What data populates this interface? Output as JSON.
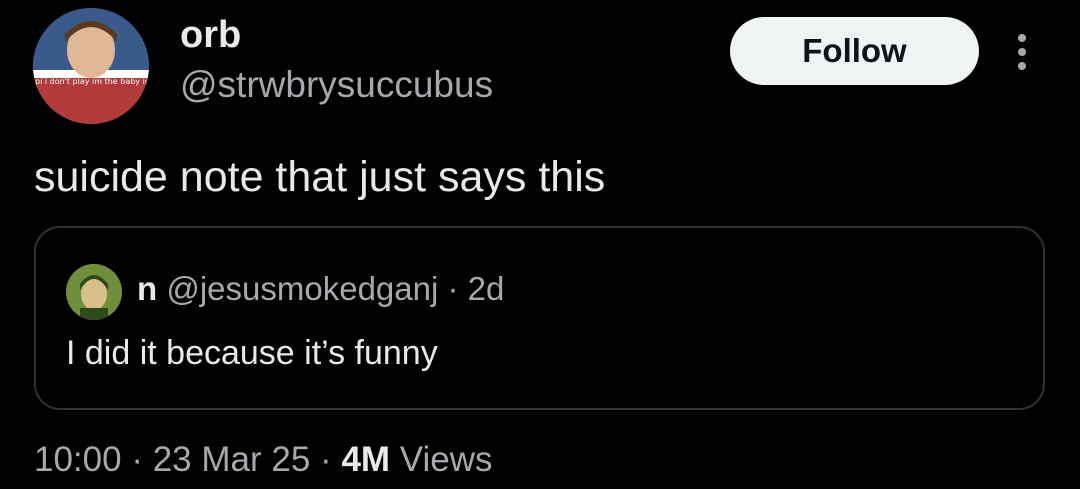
{
  "tweet": {
    "author": {
      "display_name": "orb",
      "handle": "@strwbrysuccubus",
      "avatar_icon": "profile-avatar-image",
      "avatar_caption": "she like papi i don't play im the baby isn't normal"
    },
    "follow_label": "Follow",
    "text": "suicide note that just says this",
    "quoted": {
      "display_name": "n",
      "handle": "@jesusmokedganj",
      "separator": "·",
      "age": "2d",
      "text": "I did it because it’s funny",
      "avatar_icon": "profile-avatar-image"
    },
    "meta": {
      "time": "10:00",
      "sep1": "·",
      "date": "23 Mar 25",
      "sep2": "·",
      "views_count": "4M",
      "views_label": "Views"
    }
  },
  "colors": {
    "background": "#000000",
    "text_primary": "#e7e9ea",
    "text_secondary": "#a5a9ad",
    "follow_button_bg": "#eff3f4",
    "border": "#2f3336"
  }
}
